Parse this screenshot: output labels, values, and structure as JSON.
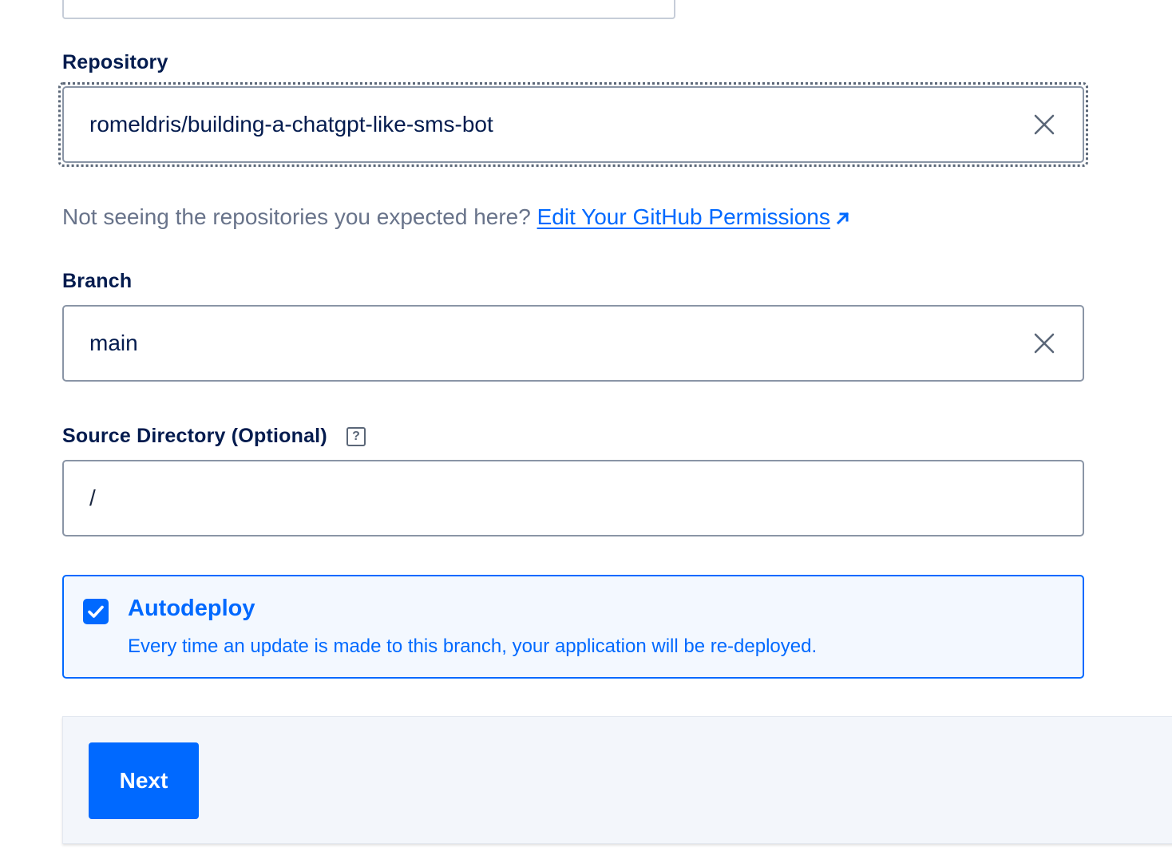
{
  "repository": {
    "label": "Repository",
    "value": "romeldris/building-a-chatgpt-like-sms-bot",
    "clear_icon": "close-icon"
  },
  "hint": {
    "text": "Not seeing the repositories you expected here? ",
    "link_label": "Edit Your GitHub Permissions",
    "link_icon": "external-link-arrow-icon"
  },
  "branch": {
    "label": "Branch",
    "value": "main",
    "clear_icon": "close-icon"
  },
  "source_directory": {
    "label": "Source Directory (Optional)",
    "help_badge": "?",
    "value": "/"
  },
  "autodeploy": {
    "checked": true,
    "title": "Autodeploy",
    "description": "Every time an update is made to this branch, your application will be re-deployed."
  },
  "footer": {
    "next_label": "Next"
  },
  "colors": {
    "accent": "#0069ff",
    "text": "#031b4e",
    "muted": "#68738a",
    "border": "#8a95a6"
  }
}
